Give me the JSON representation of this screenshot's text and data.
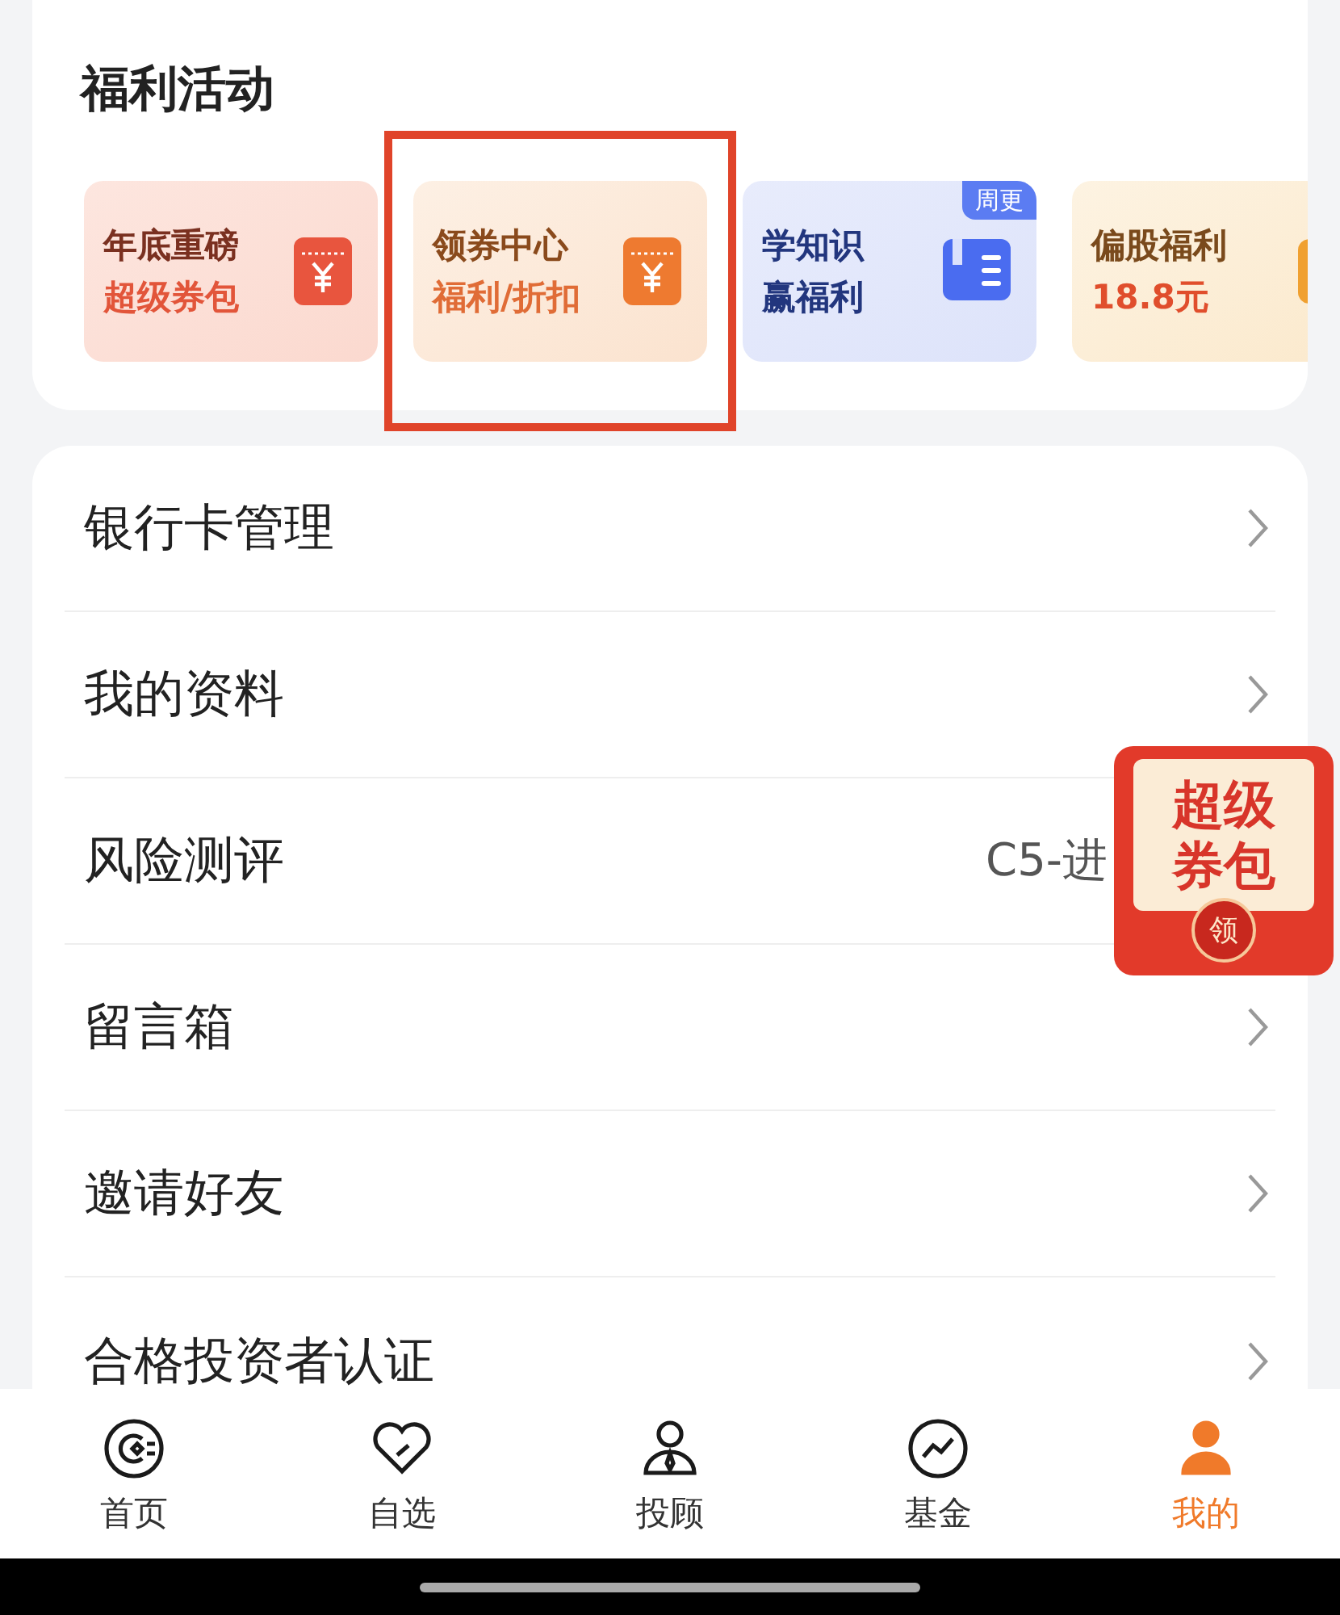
{
  "welfare": {
    "title": "福利活动",
    "tiles": [
      {
        "kind": "packet",
        "title": "年底重磅",
        "subtitle": "超级券包",
        "highlighted": false
      },
      {
        "kind": "coupon",
        "title": "领券中心",
        "subtitle": "福利/折扣",
        "highlighted": true
      },
      {
        "kind": "book",
        "title": "学知识",
        "subtitle": "赢福利",
        "badge": "周更",
        "highlighted": false
      },
      {
        "kind": "gift",
        "title": "偏股福利",
        "subtitle": "18.8元",
        "highlighted": false
      }
    ]
  },
  "menu": [
    {
      "label": "银行卡管理"
    },
    {
      "label": "我的资料"
    },
    {
      "label": "风险测评",
      "value": "C5-进"
    },
    {
      "label": "留言箱"
    },
    {
      "label": "邀请好友"
    },
    {
      "label": "合格投资者认证"
    }
  ],
  "floating_promo": {
    "title": "超级券包",
    "button": "领"
  },
  "tab_bar": [
    {
      "kind": "home",
      "label": "首页",
      "selected": false
    },
    {
      "kind": "heart",
      "label": "自选",
      "selected": false
    },
    {
      "kind": "advisor",
      "label": "投顾",
      "selected": false
    },
    {
      "kind": "fund",
      "label": "基金",
      "selected": false
    },
    {
      "kind": "me",
      "label": "我的",
      "selected": true
    }
  ]
}
